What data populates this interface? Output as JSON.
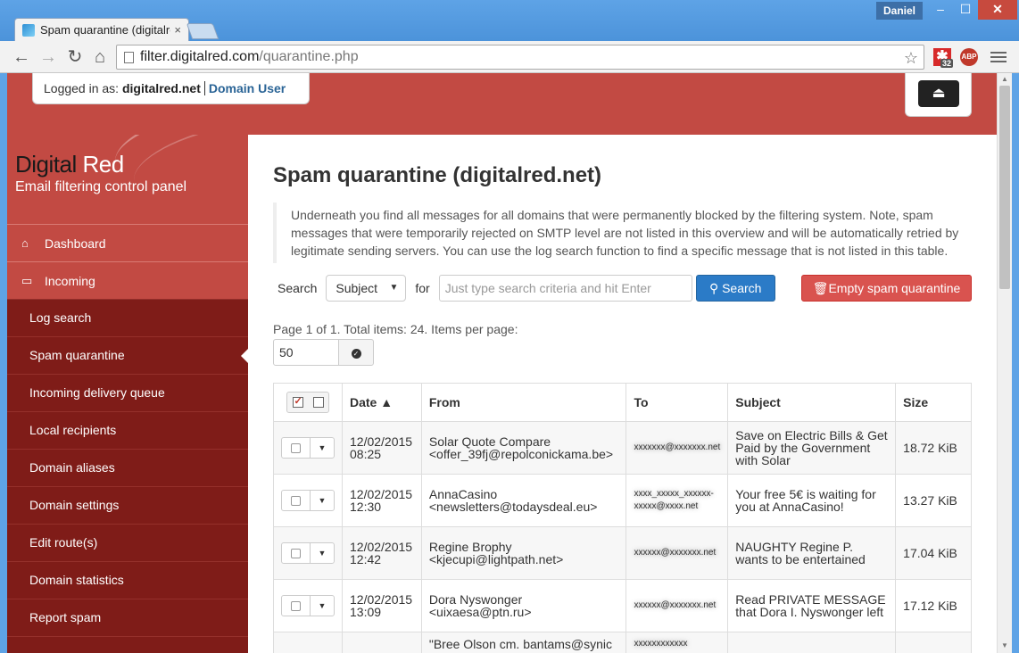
{
  "browser": {
    "tab_title": "Spam quarantine (digitalre",
    "tab_close": "×",
    "user": "Daniel",
    "url_host": "filter.digitalred.com",
    "url_path": "/quarantine.php",
    "ext_badge": "32",
    "ext_abp": "ABP",
    "min": "–",
    "max": "☐",
    "close": "✕"
  },
  "header": {
    "logged_in_label": "Logged in as:",
    "domain": "digitalred.net",
    "role": "Domain User",
    "logout_icon": "⏏"
  },
  "brand": {
    "name_part1": "Digital ",
    "name_part2": "Red",
    "tagline": "Email filtering control panel"
  },
  "sidebar": {
    "top": [
      {
        "label": "Dashboard",
        "icon": "home-icon",
        "glyph": "⌂"
      },
      {
        "label": "Incoming",
        "icon": "inbox-icon",
        "glyph": "▭"
      }
    ],
    "items": [
      {
        "label": "Log search"
      },
      {
        "label": "Spam quarantine"
      },
      {
        "label": "Incoming delivery queue"
      },
      {
        "label": "Local recipients"
      },
      {
        "label": "Domain aliases"
      },
      {
        "label": "Domain settings"
      },
      {
        "label": "Edit route(s)"
      },
      {
        "label": "Domain statistics"
      },
      {
        "label": "Report spam"
      }
    ]
  },
  "main": {
    "title": "Spam quarantine (digitalred.net)",
    "note": "Underneath you find all messages for all domains that were permanently blocked by the filtering system. Note, spam messages that were temporarily rejected on SMTP level are not listed in this overview and will be automatically retried by legitimate sending servers. You can use the log search function to find a specific message that is not listed in this table.",
    "search_label": "Search",
    "search_field": "Subject",
    "for_label": "for",
    "search_placeholder": "Just type search criteria and hit Enter",
    "search_button": "Search",
    "empty_button": "Empty spam quarantine",
    "page_info": "Page 1 of 1. Total items: 24. Items per page:",
    "per_page": "50",
    "columns": {
      "date": "Date ▲",
      "from": "From",
      "to": "To",
      "subject": "Subject",
      "size": "Size"
    },
    "rows": [
      {
        "date": "12/02/2015",
        "time": "08:25",
        "from": "Solar Quote Compare <offer_39fj@repolconickama.be>",
        "to": "xxxxxxx@xxxxxxx.net",
        "subject": "Save on Electric Bills & Get Paid by the Government with Solar",
        "size": "18.72 KiB"
      },
      {
        "date": "12/02/2015",
        "time": "12:30",
        "from": "AnnaCasino <newsletters@todaysdeal.eu>",
        "to": "xxxx_xxxxx_xxxxxx-xxxxx@xxxx.net",
        "subject": "Your free 5€ is waiting for you at AnnaCasino!",
        "size": "13.27 KiB"
      },
      {
        "date": "12/02/2015",
        "time": "12:42",
        "from": "Regine Brophy <kjecupi@lightpath.net>",
        "to": "xxxxxx@xxxxxxx.net",
        "subject": "NAUGHTY Regine P. wants to be entertained",
        "size": "17.04 KiB"
      },
      {
        "date": "12/02/2015",
        "time": "13:09",
        "from": "Dora Nyswonger <uixaesa@ptn.ru>",
        "to": "xxxxxx@xxxxxxx.net",
        "subject": "Read PRIVATE MESSAGE that Dora I. Nyswonger left",
        "size": "17.12 KiB"
      },
      {
        "date": "",
        "time": "",
        "from": "\"Bree Olson cm. bantams@synic",
        "to": "xxxxxxxxxxxx",
        "subject": "",
        "size": ""
      }
    ]
  }
}
